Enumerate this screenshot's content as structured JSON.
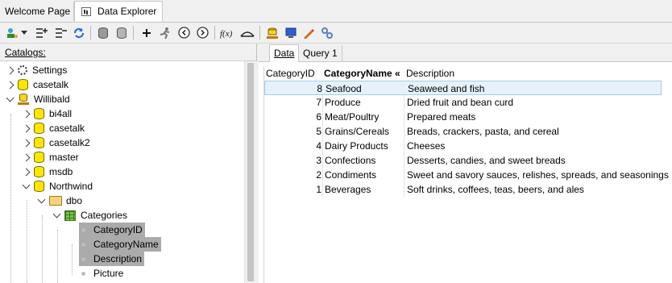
{
  "top_tabs": [
    {
      "label": "Welcome Page"
    },
    {
      "label": "Data Explorer"
    }
  ],
  "toolbar": {
    "icons": [
      "connect-icon",
      "dropdown-arrow-icon",
      "expand-all-icon",
      "collapse-all-icon",
      "refresh-icon",
      "database-gray-icon",
      "database-open-icon",
      "add-icon",
      "run-icon",
      "back-icon",
      "forward-icon",
      "function-icon",
      "bridge-icon",
      "server-icon",
      "monitor-icon",
      "pencil-icon",
      "link-icon"
    ]
  },
  "catalogs": {
    "label": "Catalogs:",
    "tree": {
      "settings": "Settings",
      "casetalk": "casetalk",
      "willibald": "Willibald",
      "children": [
        "bi4all",
        "casetalk",
        "casetalk2",
        "master",
        "msdb"
      ],
      "northwind": "Northwind",
      "schema": "dbo",
      "table": "Categories",
      "columns": [
        "CategoryID",
        "CategoryName",
        "Description",
        "Picture"
      ]
    }
  },
  "sub_tabs": [
    {
      "label": "Data"
    },
    {
      "label": "Query 1"
    }
  ],
  "grid": {
    "columns": [
      "CategoryID",
      "CategoryName «",
      "Description"
    ],
    "rows": [
      {
        "id": "8",
        "name": "Seafood",
        "desc": "Seaweed and fish"
      },
      {
        "id": "7",
        "name": "Produce",
        "desc": "Dried fruit and bean curd"
      },
      {
        "id": "6",
        "name": "Meat/Poultry",
        "desc": "Prepared meats"
      },
      {
        "id": "5",
        "name": "Grains/Cereals",
        "desc": "Breads, crackers, pasta, and cereal"
      },
      {
        "id": "4",
        "name": "Dairy Products",
        "desc": "Cheeses"
      },
      {
        "id": "3",
        "name": "Confections",
        "desc": "Desserts, candies, and sweet breads"
      },
      {
        "id": "2",
        "name": "Condiments",
        "desc": "Sweet and savory sauces, relishes, spreads, and seasonings"
      },
      {
        "id": "1",
        "name": "Beverages",
        "desc": "Soft drinks, coffees, teas, beers, and ales"
      }
    ]
  }
}
